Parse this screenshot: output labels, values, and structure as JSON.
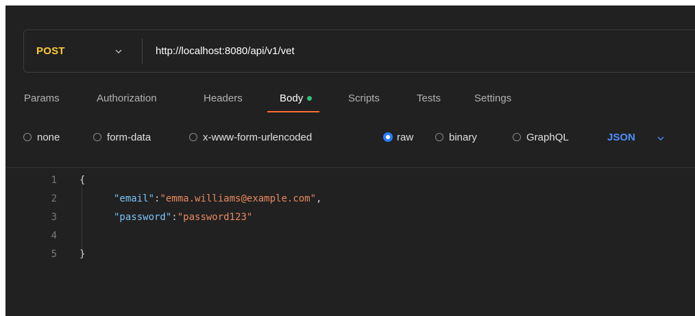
{
  "request": {
    "method": "POST",
    "url": "http://localhost:8080/api/v1/vet"
  },
  "tabs": [
    {
      "label": "Params"
    },
    {
      "label": "Authorization"
    },
    {
      "label": "Headers"
    },
    {
      "label": "Body",
      "active": true,
      "has_indicator": true
    },
    {
      "label": "Scripts"
    },
    {
      "label": "Tests"
    },
    {
      "label": "Settings"
    }
  ],
  "body_types": [
    {
      "label": "none",
      "checked": false
    },
    {
      "label": "form-data",
      "checked": false
    },
    {
      "label": "x-www-form-urlencoded",
      "checked": false
    },
    {
      "label": "raw",
      "checked": true
    },
    {
      "label": "binary",
      "checked": false
    },
    {
      "label": "GraphQL",
      "checked": false
    }
  ],
  "raw_format": "JSON",
  "editor": {
    "line_numbers": [
      "1",
      "2",
      "3",
      "4",
      "5"
    ],
    "lines": [
      {
        "open": "{"
      },
      {
        "key": "\"email\"",
        "colon": ":",
        "value": "\"emma.williams@example.com\"",
        "comma": ","
      },
      {
        "key": "\"password\"",
        "colon": ":",
        "value": "\"password123\"",
        "comma": ""
      },
      {},
      {
        "close": "}"
      }
    ]
  },
  "colors": {
    "method": "#ffcc33",
    "active_tab_underline": "#ff6c37",
    "body_indicator_dot": "#2ec27e",
    "json_selector": "#4d90ff",
    "json_key": "#7cc4f7",
    "json_string": "#e88a60",
    "background": "#212121"
  }
}
